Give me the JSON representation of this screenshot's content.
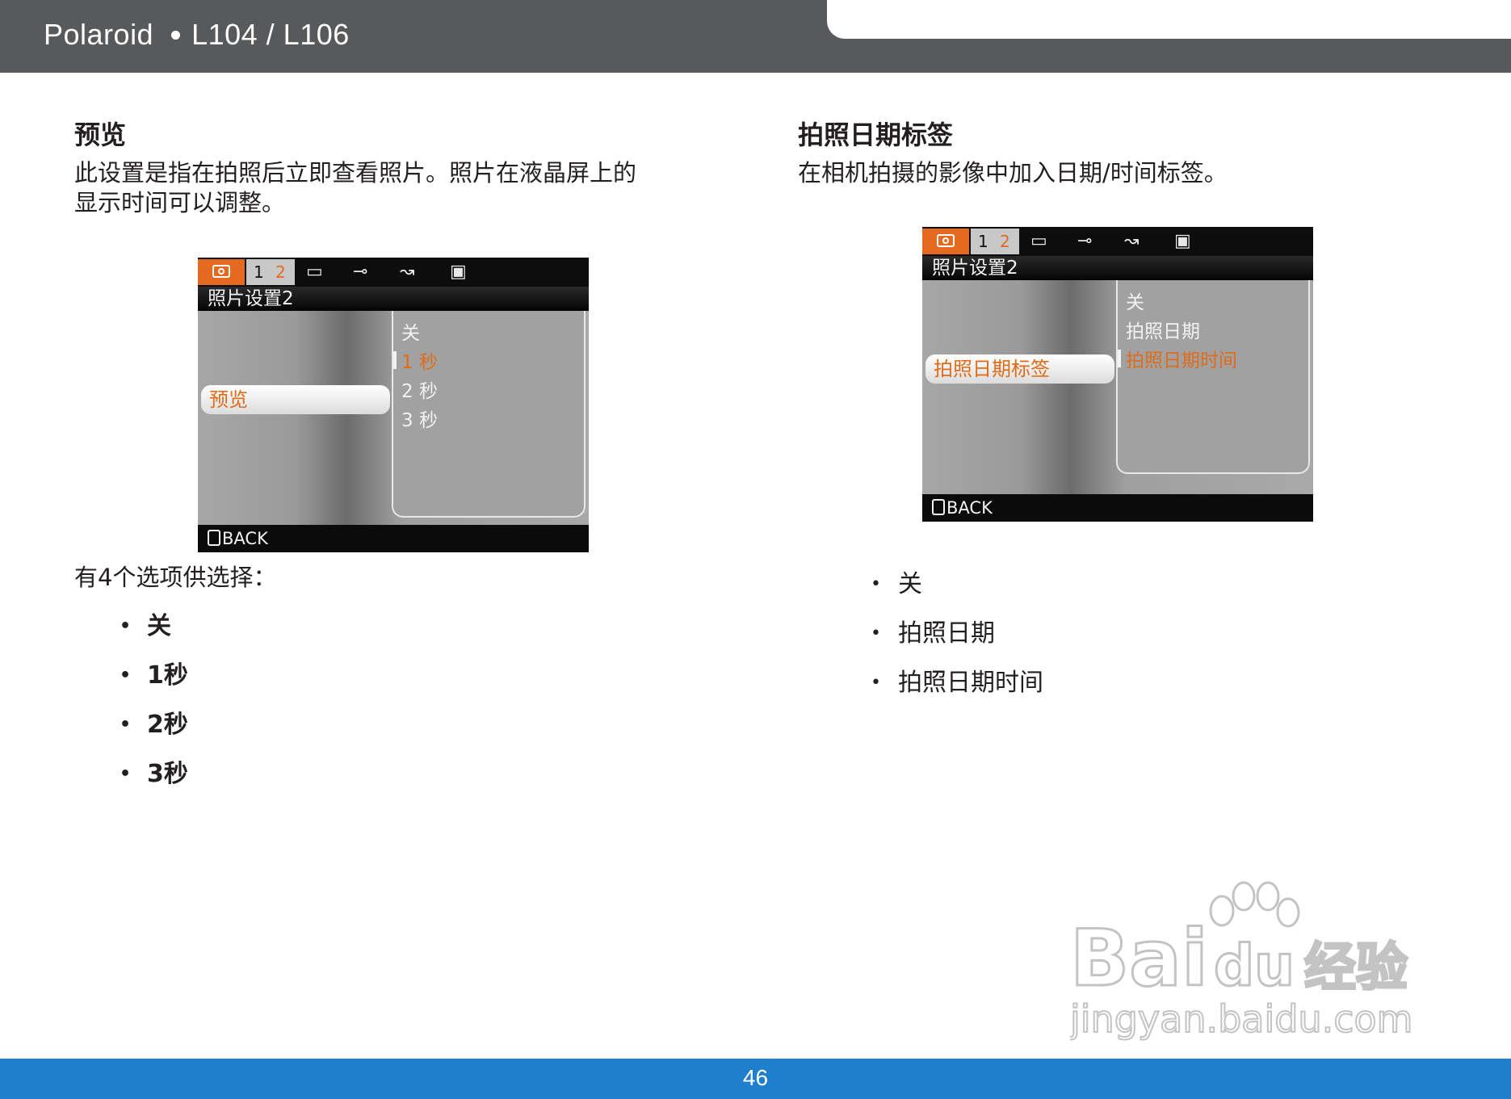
{
  "header": {
    "brand": "Polaroid",
    "model": "L104 / L106"
  },
  "left": {
    "heading": "预览",
    "paragraph_line1": "此设置是指在拍照后立即查看照片。照片在液晶屏上的",
    "paragraph_line2": "显示时间可以调整。",
    "screen": {
      "tab_page1": "1",
      "tab_page2": "2",
      "subtitle": "照片设置2",
      "selected_item": "预览",
      "options": [
        "关",
        "1 秒",
        "2 秒",
        "3 秒"
      ],
      "back": "BACK"
    },
    "options_intro": "有4个选项供选择：",
    "bullets": [
      "关",
      "1秒",
      "2秒",
      "3秒"
    ]
  },
  "right": {
    "heading": "拍照日期标签",
    "paragraph": "在相机拍摄的影像中加入日期/时间标签。",
    "screen": {
      "tab_page1": "1",
      "tab_page2": "2",
      "subtitle": "照片设置2",
      "selected_item": "拍照日期标签",
      "options": [
        "关",
        "拍照日期",
        "拍照日期时间"
      ],
      "back": "BACK"
    },
    "bullets": [
      "关",
      "拍照日期",
      "拍照日期时间"
    ]
  },
  "footer": {
    "page_number": "46"
  },
  "watermark": {
    "brand": "Baidu经验",
    "url": "jingyan.baidu.com"
  },
  "colors": {
    "header_bg": "#58595b",
    "footer_bg": "#1f7fcc",
    "accent_orange": "#e56a1f"
  }
}
